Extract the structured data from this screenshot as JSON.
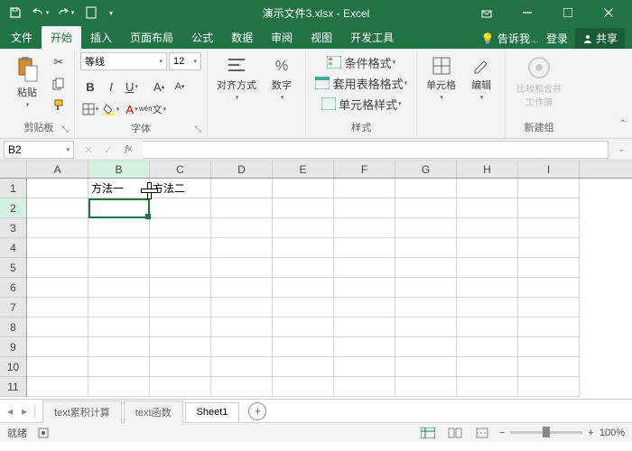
{
  "title": "演示文件3.xlsx - Excel",
  "tabs": {
    "file": "文件",
    "start": "开始",
    "insert": "插入",
    "layout": "页面布局",
    "formula": "公式",
    "data": "数据",
    "review": "审阅",
    "view": "视图",
    "dev": "开发工具",
    "tell": "告诉我...",
    "login": "登录",
    "share": "共享"
  },
  "ribbon": {
    "clipboard": {
      "paste": "粘贴",
      "label": "剪贴板"
    },
    "font": {
      "name": "等线",
      "size": "12",
      "label": "字体"
    },
    "align": {
      "btn": "对齐方式",
      "num": "数字"
    },
    "styles": {
      "cond": "条件格式",
      "tbl": "套用表格格式",
      "cell": "单元格样式",
      "label": "样式"
    },
    "cells": {
      "btn": "单元格",
      "edit": "编辑"
    },
    "new": {
      "btn": "比较和合并工作簿",
      "label": "新建组"
    }
  },
  "namebox": "B2",
  "cols": [
    "A",
    "B",
    "C",
    "D",
    "E",
    "F",
    "G",
    "H",
    "I"
  ],
  "rows": [
    "1",
    "2",
    "3",
    "4",
    "5",
    "6",
    "7",
    "8",
    "9",
    "10",
    "11"
  ],
  "cellData": {
    "B1": "方法一",
    "C1": "方法二"
  },
  "sheets": {
    "s1": "text累积计算",
    "s2": "text函数",
    "s3": "Sheet1"
  },
  "status": {
    "ready": "就绪",
    "calc": "",
    "zoom": "100%"
  }
}
